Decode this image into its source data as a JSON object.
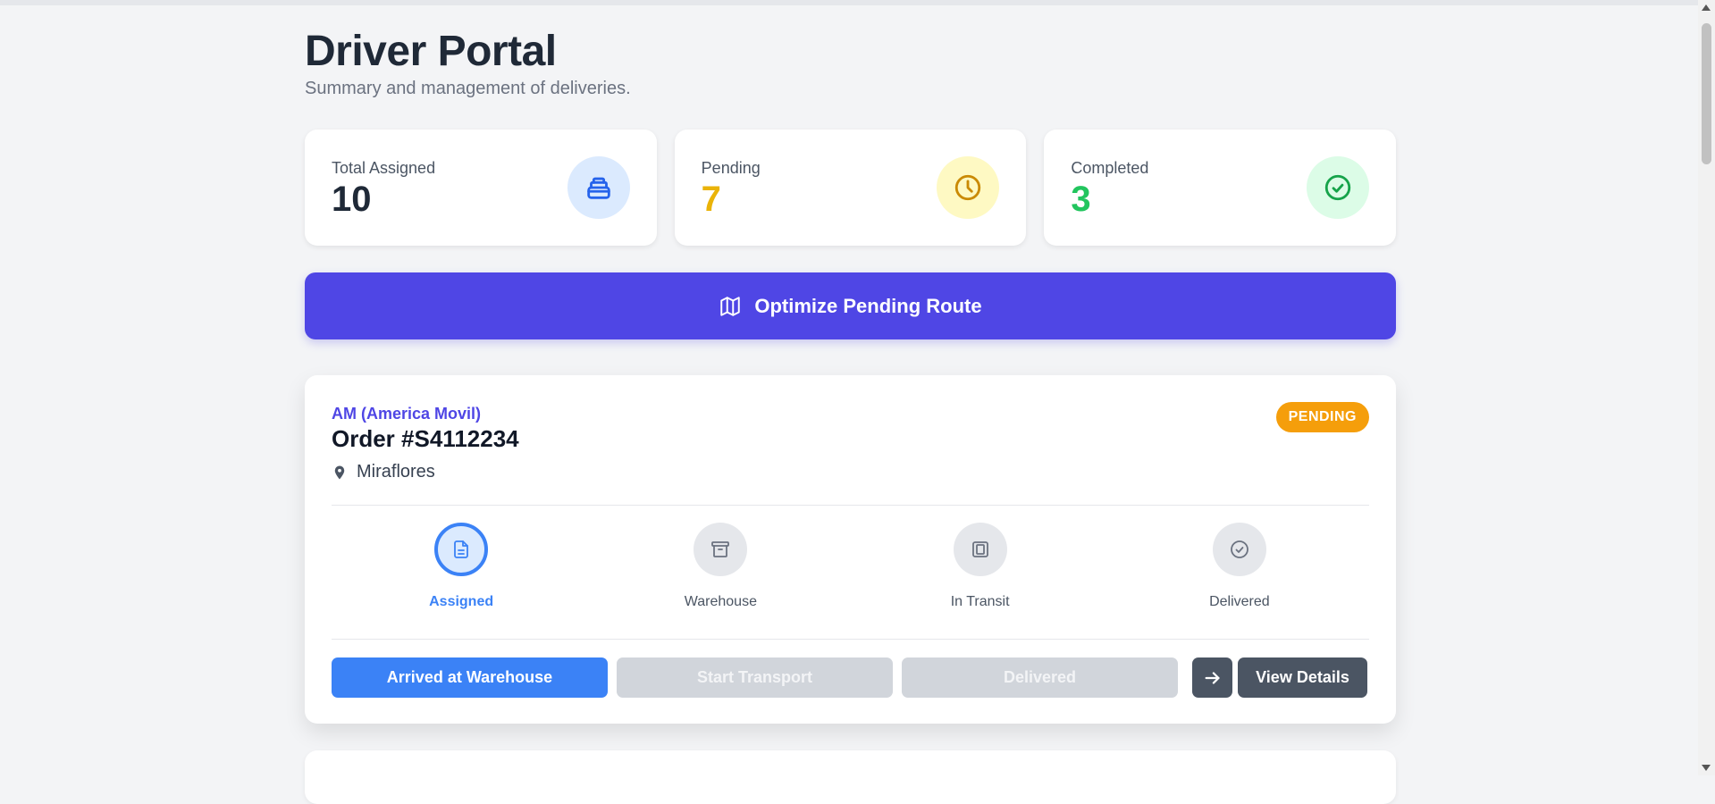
{
  "header": {
    "title": "Driver Portal",
    "subtitle": "Summary and management of deliveries."
  },
  "stats": [
    {
      "label": "Total Assigned",
      "value": "10",
      "icon": "inbox-stack-icon",
      "value_color": "#1f2937",
      "icon_bg": "#dbeafe",
      "icon_color": "#2563eb"
    },
    {
      "label": "Pending",
      "value": "7",
      "icon": "clock-icon",
      "value_color": "#eab308",
      "icon_bg": "#fef9c3",
      "icon_color": "#ca8a04"
    },
    {
      "label": "Completed",
      "value": "3",
      "icon": "check-circle-icon",
      "value_color": "#22c55e",
      "icon_bg": "#dcfce7",
      "icon_color": "#16a34a"
    }
  ],
  "optimize_button": {
    "label": "Optimize Pending Route",
    "icon": "map-icon",
    "color": "#4f46e5"
  },
  "order": {
    "company": "AM (America Movil)",
    "title": "Order #S4112234",
    "location": "Miraflores",
    "status": "PENDING",
    "status_color": "#f59e0b",
    "steps": [
      {
        "label": "Assigned",
        "icon": "document-icon",
        "active": true
      },
      {
        "label": "Warehouse",
        "icon": "archive-box-icon",
        "active": false
      },
      {
        "label": "In Transit",
        "icon": "truck-icon",
        "active": false
      },
      {
        "label": "Delivered",
        "icon": "check-circle-icon",
        "active": false
      }
    ],
    "actions": {
      "arrived": "Arrived at Warehouse",
      "start": "Start Transport",
      "delivered": "Delivered",
      "details": "View Details"
    }
  }
}
